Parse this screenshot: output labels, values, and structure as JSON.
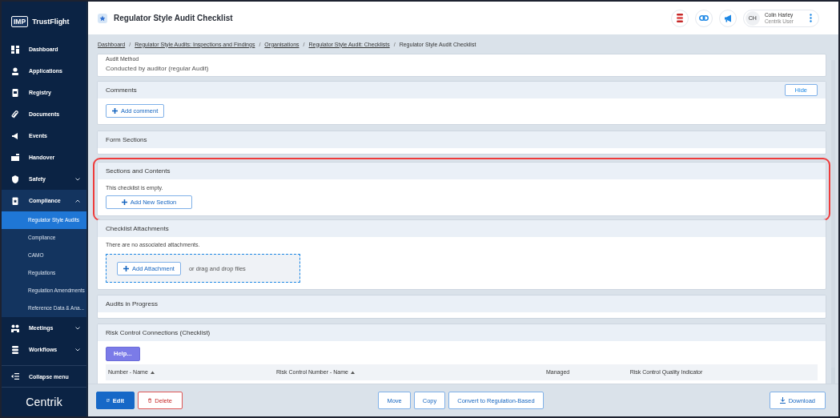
{
  "brand": {
    "badge": "IMP",
    "name": "TrustFlight"
  },
  "sidebar": {
    "items": [
      {
        "label": "Dashboard",
        "selected": false
      },
      {
        "label": "Applications",
        "selected": false
      },
      {
        "label": "Registry",
        "selected": false
      },
      {
        "label": "Documents",
        "selected": false
      },
      {
        "label": "Events",
        "selected": false
      },
      {
        "label": "Handover",
        "selected": false
      },
      {
        "label": "Safety",
        "selected": false,
        "expanded": false
      },
      {
        "label": "Compliance",
        "selected": false,
        "expanded": true,
        "children": [
          {
            "label": "Regulator Style Audits",
            "selected": true
          },
          {
            "label": "Compliance",
            "selected": false
          },
          {
            "label": "CAMO",
            "selected": false
          },
          {
            "label": "Regulations",
            "selected": false
          },
          {
            "label": "Regulation Amendments",
            "selected": false
          },
          {
            "label": "Reference Data & Ana...",
            "selected": false
          }
        ]
      },
      {
        "label": "Meetings",
        "selected": false,
        "expanded": false
      },
      {
        "label": "Workflows",
        "selected": false,
        "expanded": false
      }
    ],
    "collapse": "Collapse menu",
    "footer_logo": "Centrik"
  },
  "header": {
    "title": "Regulator Style Audit Checklist",
    "user": {
      "initials": "CH",
      "name": "Colin Harley",
      "role": "Centrik User"
    }
  },
  "breadcrumb": {
    "separator": "/",
    "items": [
      {
        "label": "Dashboard",
        "link": true
      },
      {
        "label": "Regulator Style Audits: Inspections and Findings",
        "link": true
      },
      {
        "label": "Organisations",
        "link": true
      },
      {
        "label": "Regulator Style Audit: Checklists",
        "link": true
      },
      {
        "label": "Regulator Style Audit Checklist",
        "link": false
      }
    ]
  },
  "cards": [
    {
      "kind": "field",
      "label": "Audit Method",
      "value": "Conducted by auditor (regular Audit)"
    },
    {
      "kind": "comments",
      "title": "Comments",
      "hide_button": "Hide",
      "button": "Add comment"
    },
    {
      "kind": "empty",
      "title": "Form Sections"
    },
    {
      "kind": "sections",
      "title": "Sections and Contents",
      "highlighted": true,
      "message": "This checklist is empty.",
      "button": "Add New Section"
    },
    {
      "kind": "attachments",
      "title": "Checklist Attachments",
      "message": "There are no associated attachments.",
      "button": "Add Attachment",
      "drop_text": "or drag and drop files"
    },
    {
      "kind": "empty",
      "title": "Audits in Progress"
    },
    {
      "kind": "table",
      "title": "Risk Control Connections (Checklist)",
      "button": "Help...",
      "columns": [
        {
          "label": "Number - Name",
          "sortable": true
        },
        {
          "label": "Risk Control Number - Name",
          "sortable": true
        },
        {
          "label": "Managed",
          "sortable": false
        },
        {
          "label": "Risk Control Quality Indicator",
          "sortable": false
        }
      ]
    }
  ],
  "actions": {
    "left": [
      {
        "label": "Edit",
        "kind": "primary"
      },
      {
        "label": "Delete",
        "kind": "danger"
      }
    ],
    "center": [
      {
        "label": "Move"
      },
      {
        "label": "Copy"
      },
      {
        "label": "Convert to Regulation-Based"
      }
    ],
    "right": [
      {
        "label": "Download",
        "kind": "download"
      }
    ]
  }
}
